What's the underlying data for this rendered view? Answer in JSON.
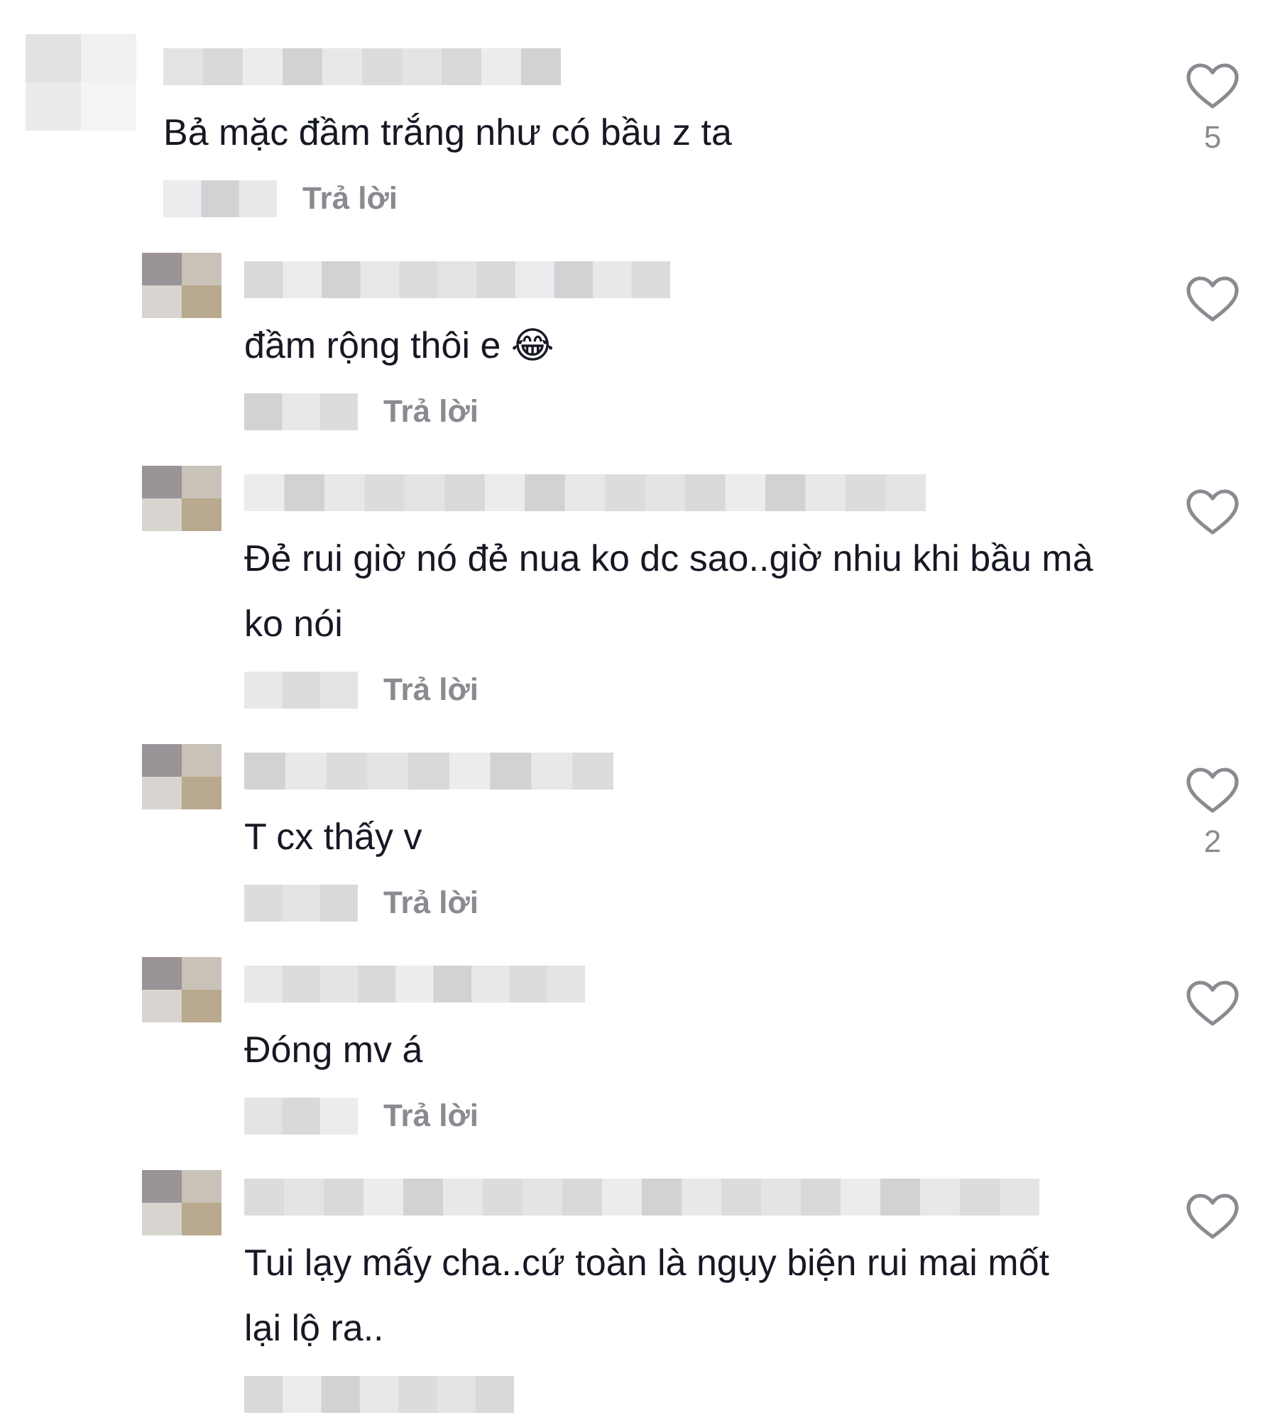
{
  "comments": [
    {
      "kind": "top",
      "text": "Bả mặc đầm trắng như có bầu z ta",
      "reply_label": "Trả lời",
      "likes": "5",
      "liked": false
    },
    {
      "kind": "reply",
      "text": "đầm rộng thôi e 😂",
      "reply_label": "Trả lời",
      "liked": false
    },
    {
      "kind": "reply",
      "text": "Đẻ rui giờ nó đẻ nua ko dc sao..giờ nhiu khi bầu mà ko nói",
      "reply_label": "Trả lời",
      "liked": false
    },
    {
      "kind": "reply",
      "text": "T cx thấy v",
      "reply_label": "Trả lời",
      "likes": "2",
      "liked": false
    },
    {
      "kind": "reply",
      "text": "Đóng mv á",
      "reply_label": "Trả lời",
      "liked": false
    },
    {
      "kind": "reply",
      "text": "Tui lạy mấy cha..cứ toàn là ngụy biện rui mai mốt lại lộ ra..",
      "liked": false
    }
  ]
}
